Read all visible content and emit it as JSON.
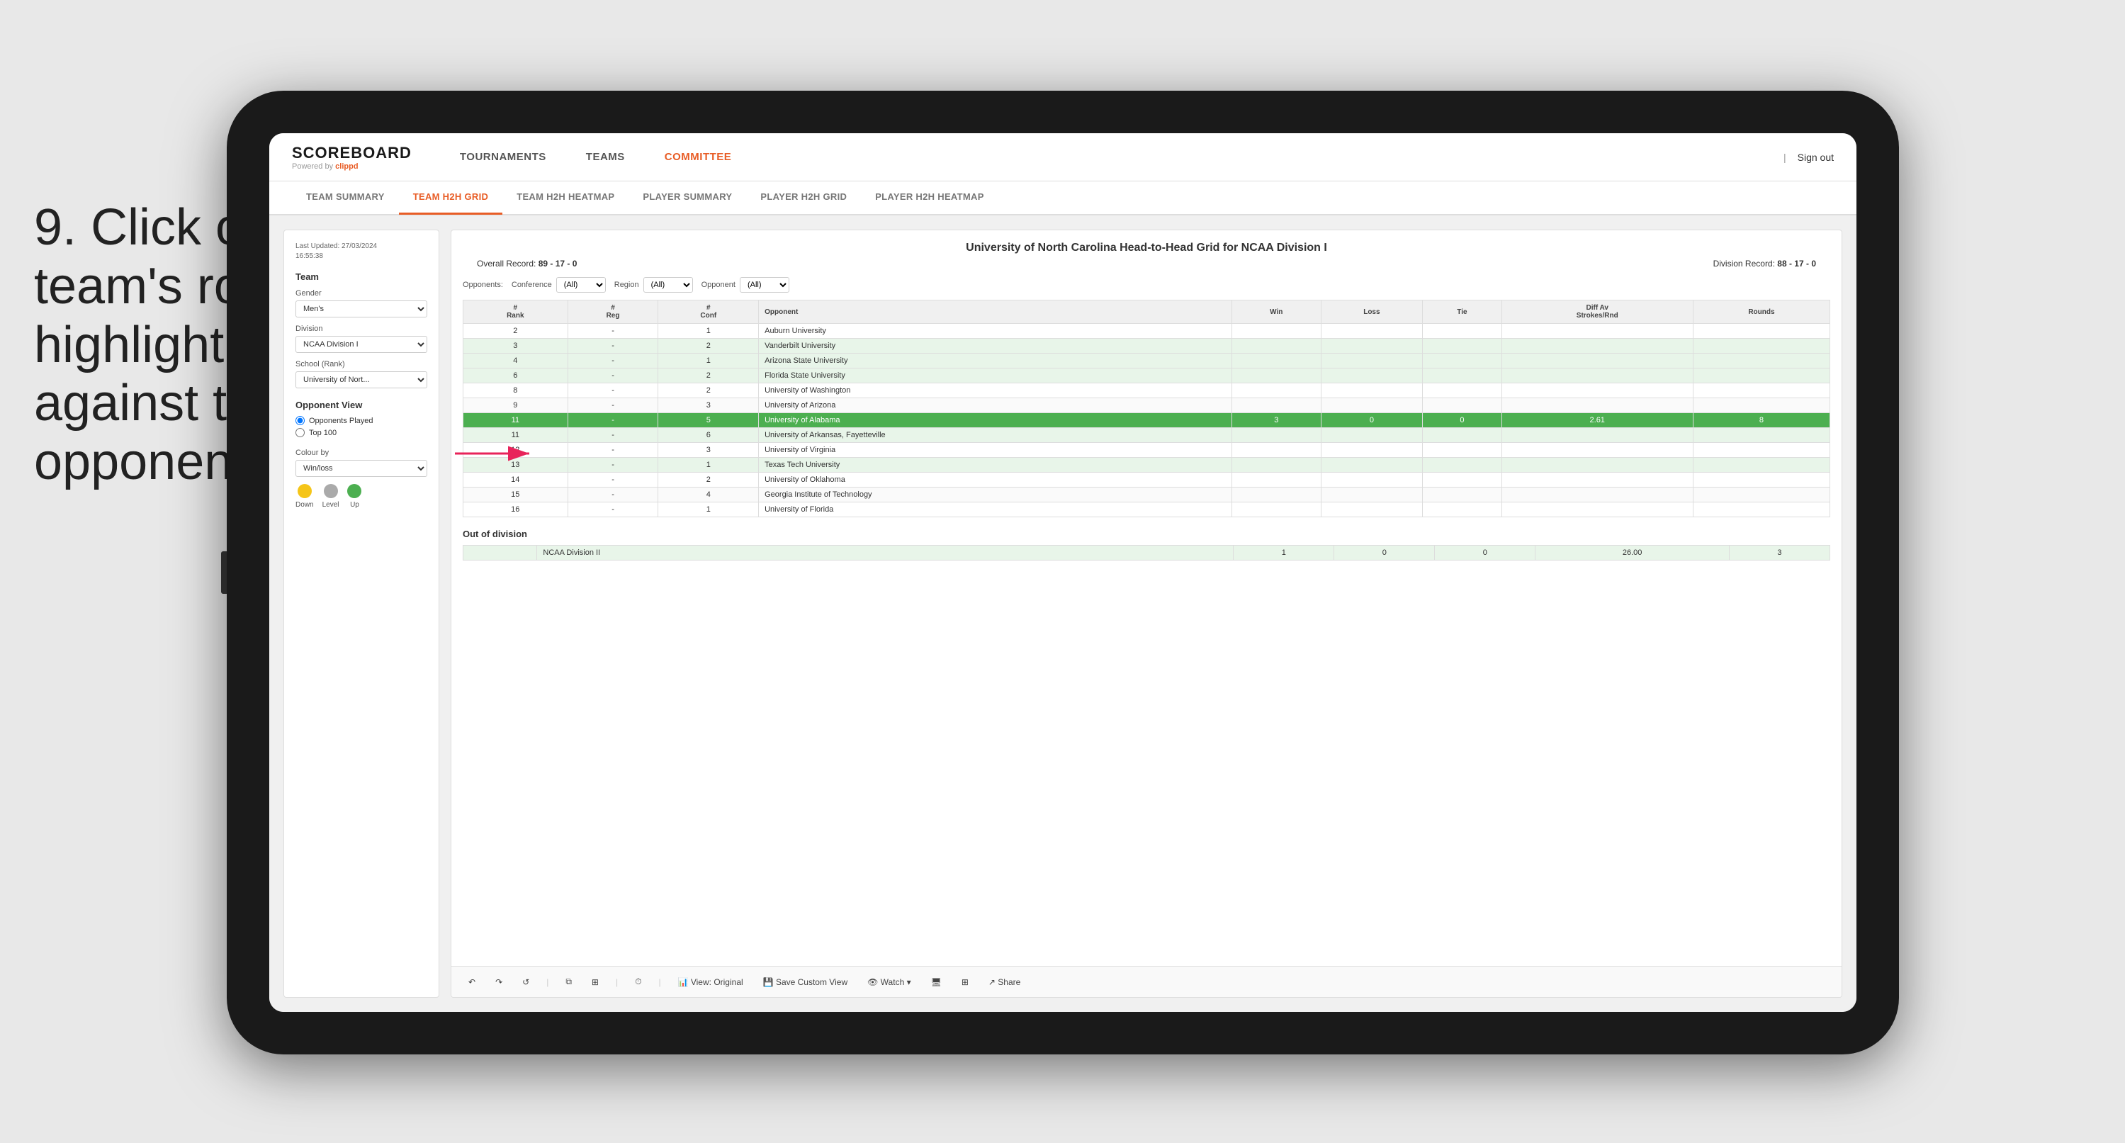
{
  "instruction": {
    "step": "9.",
    "text": "Click on a team's row to highlight results against that opponent"
  },
  "tablet": {
    "nav": {
      "logo": "SCOREBOARD",
      "powered_by": "Powered by",
      "brand": "clippd",
      "items": [
        "TOURNAMENTS",
        "TEAMS",
        "COMMITTEE"
      ],
      "active_item": "COMMITTEE",
      "sign_out_label": "Sign out"
    },
    "sub_nav": {
      "items": [
        "TEAM SUMMARY",
        "TEAM H2H GRID",
        "TEAM H2H HEATMAP",
        "PLAYER SUMMARY",
        "PLAYER H2H GRID",
        "PLAYER H2H HEATMAP"
      ],
      "active_item": "TEAM H2H GRID"
    },
    "sidebar": {
      "last_updated_label": "Last Updated: 27/03/2024",
      "time": "16:55:38",
      "team_section_title": "Team",
      "gender_label": "Gender",
      "gender_value": "Men's",
      "division_label": "Division",
      "division_value": "NCAA Division I",
      "school_label": "School (Rank)",
      "school_value": "University of Nort...",
      "opponent_view_title": "Opponent View",
      "opponent_option1": "Opponents Played",
      "opponent_option2": "Top 100",
      "colour_by_label": "Colour by",
      "colour_by_value": "Win/loss",
      "legend_down": "Down",
      "legend_level": "Level",
      "legend_up": "Up"
    },
    "grid": {
      "title": "University of North Carolina Head-to-Head Grid for NCAA Division I",
      "overall_record_label": "Overall Record:",
      "overall_record_value": "89 - 17 - 0",
      "division_record_label": "Division Record:",
      "division_record_value": "88 - 17 - 0",
      "filters": {
        "opponents_label": "Opponents:",
        "conference_label": "Conference",
        "conference_value": "(All)",
        "region_label": "Region",
        "region_value": "(All)",
        "opponent_label": "Opponent",
        "opponent_value": "(All)"
      },
      "table_headers": [
        "#\nRank",
        "#\nReg",
        "#\nConf",
        "Opponent",
        "Win",
        "Loss",
        "Tie",
        "Diff Av\nStrokes/Rnd",
        "Rounds"
      ],
      "rows": [
        {
          "rank": "2",
          "reg": "-",
          "conf": "1",
          "opponent": "Auburn University",
          "win": "",
          "loss": "",
          "tie": "",
          "diff": "",
          "rounds": "",
          "style": "normal"
        },
        {
          "rank": "3",
          "reg": "-",
          "conf": "2",
          "opponent": "Vanderbilt University",
          "win": "",
          "loss": "",
          "tie": "",
          "diff": "",
          "rounds": "",
          "style": "light-green"
        },
        {
          "rank": "4",
          "reg": "-",
          "conf": "1",
          "opponent": "Arizona State University",
          "win": "",
          "loss": "",
          "tie": "",
          "diff": "",
          "rounds": "",
          "style": "light-green"
        },
        {
          "rank": "6",
          "reg": "-",
          "conf": "2",
          "opponent": "Florida State University",
          "win": "",
          "loss": "",
          "tie": "",
          "diff": "",
          "rounds": "",
          "style": "light-green"
        },
        {
          "rank": "8",
          "reg": "-",
          "conf": "2",
          "opponent": "University of Washington",
          "win": "",
          "loss": "",
          "tie": "",
          "diff": "",
          "rounds": "",
          "style": "normal"
        },
        {
          "rank": "9",
          "reg": "-",
          "conf": "3",
          "opponent": "University of Arizona",
          "win": "",
          "loss": "",
          "tie": "",
          "diff": "",
          "rounds": "",
          "style": "normal"
        },
        {
          "rank": "11",
          "reg": "-",
          "conf": "5",
          "opponent": "University of Alabama",
          "win": "3",
          "loss": "0",
          "tie": "0",
          "diff": "2.61",
          "rounds": "8",
          "style": "highlighted"
        },
        {
          "rank": "11",
          "reg": "-",
          "conf": "6",
          "opponent": "University of Arkansas, Fayetteville",
          "win": "",
          "loss": "",
          "tie": "",
          "diff": "",
          "rounds": "",
          "style": "light-green"
        },
        {
          "rank": "12",
          "reg": "-",
          "conf": "3",
          "opponent": "University of Virginia",
          "win": "",
          "loss": "",
          "tie": "",
          "diff": "",
          "rounds": "",
          "style": "normal"
        },
        {
          "rank": "13",
          "reg": "-",
          "conf": "1",
          "opponent": "Texas Tech University",
          "win": "",
          "loss": "",
          "tie": "",
          "diff": "",
          "rounds": "",
          "style": "light-green"
        },
        {
          "rank": "14",
          "reg": "-",
          "conf": "2",
          "opponent": "University of Oklahoma",
          "win": "",
          "loss": "",
          "tie": "",
          "diff": "",
          "rounds": "",
          "style": "normal"
        },
        {
          "rank": "15",
          "reg": "-",
          "conf": "4",
          "opponent": "Georgia Institute of Technology",
          "win": "",
          "loss": "",
          "tie": "",
          "diff": "",
          "rounds": "",
          "style": "normal"
        },
        {
          "rank": "16",
          "reg": "-",
          "conf": "1",
          "opponent": "University of Florida",
          "win": "",
          "loss": "",
          "tie": "",
          "diff": "",
          "rounds": "",
          "style": "normal"
        }
      ],
      "out_of_division_label": "Out of division",
      "out_of_div_row": {
        "label": "NCAA Division II",
        "win": "1",
        "loss": "0",
        "tie": "0",
        "diff": "26.00",
        "rounds": "3"
      }
    },
    "toolbar": {
      "buttons": [
        "View: Original",
        "Save Custom View",
        "Watch ▾",
        "Share"
      ]
    }
  }
}
